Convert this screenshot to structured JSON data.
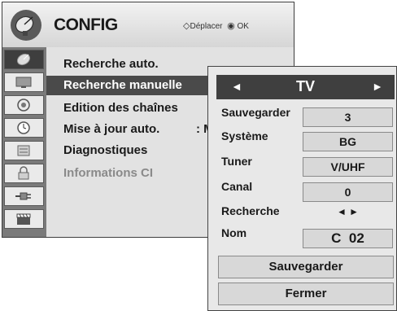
{
  "header": {
    "title": "CONFIG",
    "hint_move_icon": "◇",
    "hint_move": "Déplacer",
    "hint_ok_icon": "◉",
    "hint_ok": "OK"
  },
  "sidebar": {
    "icons": [
      "dish-icon",
      "screen-icon",
      "speaker-icon",
      "clock-icon",
      "lock-list-icon",
      "padlock-icon",
      "plug-icon",
      "clapper-icon"
    ]
  },
  "menu": {
    "items": [
      {
        "label": "Recherche auto.",
        "value": ""
      },
      {
        "label": "Recherche manuelle",
        "value": ""
      },
      {
        "label": "Edition des chaînes",
        "value": ""
      },
      {
        "label": "Mise à jour auto.",
        "value": ": M"
      },
      {
        "label": "Diagnostiques",
        "value": ""
      },
      {
        "label": "Informations CI",
        "value": ""
      }
    ],
    "selected_index": 1
  },
  "popup": {
    "mode_left": "◄",
    "mode_title": "TV",
    "mode_right": "►",
    "fields": [
      {
        "label": "Sauvegarder",
        "value": "3"
      },
      {
        "label": "Système",
        "value": "BG"
      },
      {
        "label": "Tuner",
        "value": "V/UHF"
      },
      {
        "label": "Canal",
        "value": "0"
      },
      {
        "label": "Recherche",
        "value": "◄ ►"
      },
      {
        "label": "Nom",
        "value": "C  02"
      }
    ],
    "save_button": "Sauvegarder",
    "close_button": "Fermer"
  },
  "colors": {
    "selected_bg": "#4a4a4a",
    "window_bg": "#e2e2e2",
    "sidebar_bg": "#7a7a7a"
  }
}
